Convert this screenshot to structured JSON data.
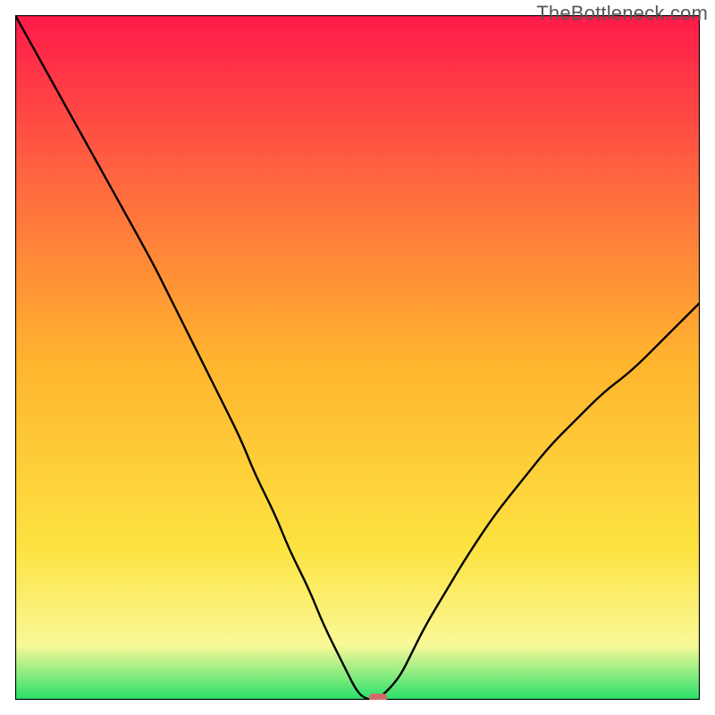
{
  "watermark": "TheBottleneck.com",
  "chart_data": {
    "type": "line",
    "title": "",
    "xlabel": "",
    "ylabel": "",
    "xlim": [
      0,
      100
    ],
    "ylim": [
      0,
      100
    ],
    "grid": false,
    "legend": false,
    "series": [
      {
        "name": "bottleneck-curve",
        "x": [
          0,
          5,
          10,
          15,
          20,
          22,
          25,
          28,
          30,
          33,
          35,
          38,
          40,
          43,
          45,
          48,
          50,
          51.5,
          53,
          56,
          58,
          60,
          63,
          66,
          70,
          74,
          78,
          82,
          86,
          90,
          95,
          100
        ],
        "y": [
          100,
          91,
          82,
          73,
          64,
          60,
          54,
          48,
          44,
          38,
          33,
          27,
          22,
          16,
          11,
          5,
          1,
          0,
          0,
          3,
          7,
          11,
          16,
          21,
          27,
          32,
          37,
          41,
          45,
          48,
          53,
          58
        ]
      }
    ],
    "marker": {
      "name": "optimal-point",
      "x": 53,
      "y": 0,
      "color": "#d26a6a"
    },
    "gradient_colors": {
      "top": "#ff1a4a",
      "q1": "#ff6a3f",
      "mid": "#ffb32e",
      "q3": "#fde341",
      "low": "#faf998",
      "bottom": "#27e06a"
    },
    "axis_stroke": "#000000"
  }
}
